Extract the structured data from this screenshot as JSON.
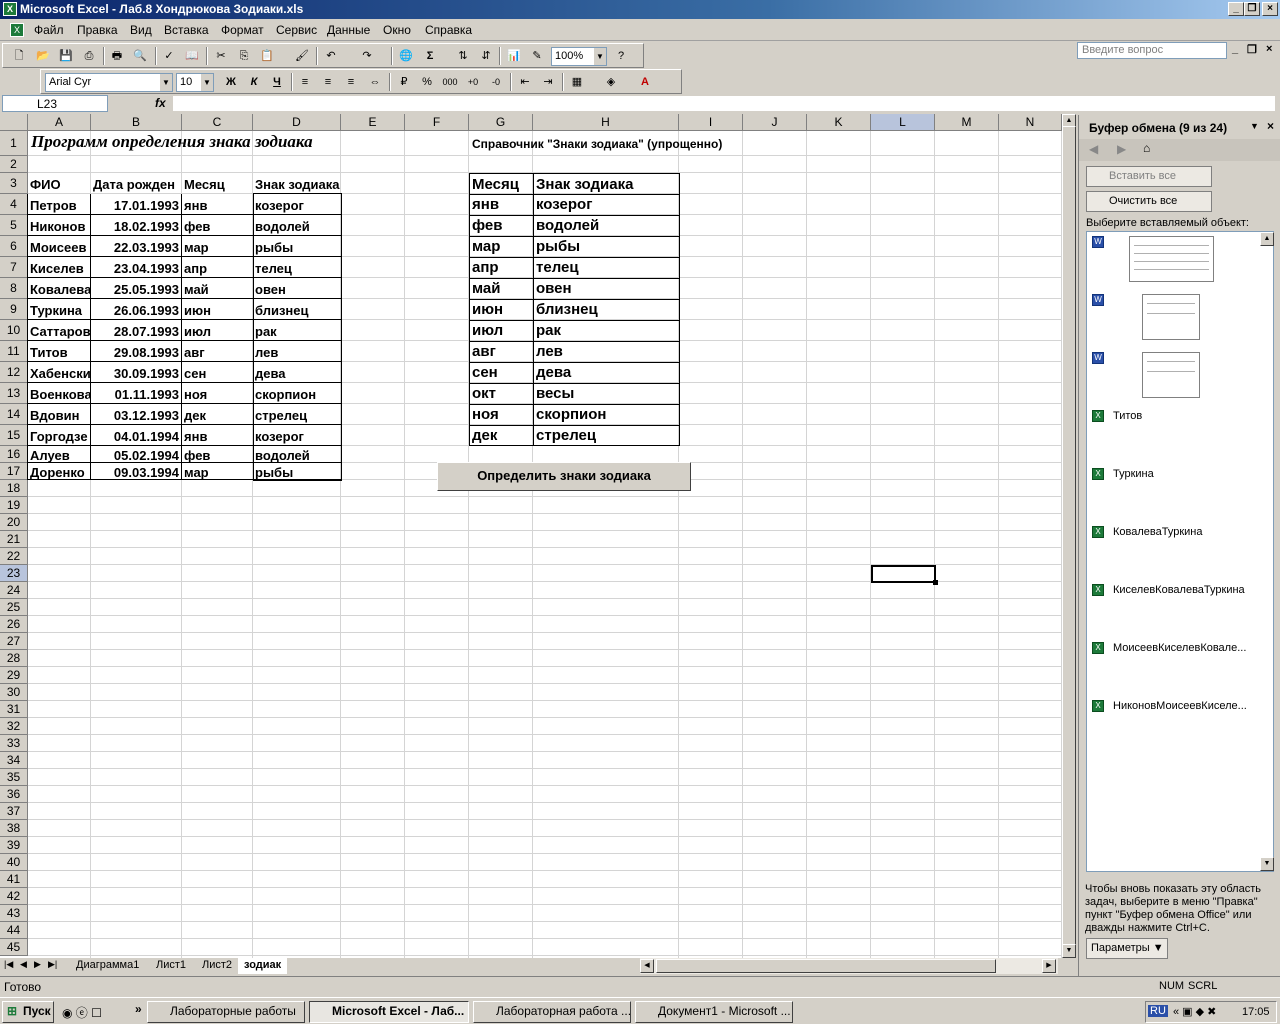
{
  "window": {
    "title": "Microsoft Excel - Лаб.8 Хондрюкова Зодиаки.xls"
  },
  "menu": [
    "Файл",
    "Правка",
    "Вид",
    "Вставка",
    "Формат",
    "Сервис",
    "Данные",
    "Окно",
    "Справка"
  ],
  "ask_placeholder": "Введите вопрос",
  "toolbar": {
    "zoom": "100%",
    "font": "Arial Cyr",
    "size": "10",
    "bold": "Ж",
    "italic": "К",
    "underline": "Ч",
    "percent": "%",
    "thousands": "000"
  },
  "formula": {
    "namebox": "L23",
    "fx": "fx",
    "value": ""
  },
  "columns": [
    "A",
    "B",
    "C",
    "D",
    "E",
    "F",
    "G",
    "H",
    "I",
    "J",
    "K",
    "L",
    "M",
    "N"
  ],
  "rows": [
    "1",
    "2",
    "3",
    "4",
    "5",
    "6",
    "7",
    "8",
    "9",
    "10",
    "11",
    "12",
    "13",
    "14",
    "15",
    "16",
    "17",
    "18",
    "19",
    "20",
    "21",
    "22",
    "23",
    "24",
    "25",
    "26",
    "27",
    "28",
    "29",
    "30",
    "31",
    "32",
    "33",
    "34",
    "35",
    "36",
    "37",
    "38",
    "39",
    "40",
    "41",
    "42",
    "43",
    "44",
    "45"
  ],
  "sheet": {
    "title": "Программ определения знака зодиака",
    "headers": [
      "ФИО",
      "Дата рожден",
      "Месяц",
      "Знак зодиака"
    ],
    "table": [
      [
        "Петров",
        "17.01.1993",
        "янв",
        "козерог"
      ],
      [
        "Никонов",
        "18.02.1993",
        "фев",
        "водолей"
      ],
      [
        "Моисеев",
        "22.03.1993",
        "мар",
        "рыбы"
      ],
      [
        "Киселев",
        "23.04.1993",
        "апр",
        "телец"
      ],
      [
        "Ковалева",
        "25.05.1993",
        "май",
        "овен"
      ],
      [
        "Туркина",
        "26.06.1993",
        "июн",
        "близнец"
      ],
      [
        "Саттаров",
        "28.07.1993",
        "июл",
        "рак"
      ],
      [
        "Титов",
        "29.08.1993",
        "авг",
        "лев"
      ],
      [
        "Хабенски",
        "30.09.1993",
        "сен",
        "дева"
      ],
      [
        "Военкова",
        "01.11.1993",
        "ноя",
        "скорпион"
      ],
      [
        "Вдовин",
        "03.12.1993",
        "дек",
        "стрелец"
      ],
      [
        "Горгодзе",
        "04.01.1994",
        "янв",
        "козерог"
      ],
      [
        "Алуев",
        "05.02.1994",
        "фев",
        "водолей"
      ],
      [
        "Доренко",
        "09.03.1994",
        "мар",
        "рыбы"
      ]
    ],
    "ref_title": "Справочник \"Знаки зодиака\" (упрощенно)",
    "ref_headers": [
      "Месяц",
      "Знак зодиака"
    ],
    "ref": [
      [
        "янв",
        "козерог"
      ],
      [
        "фев",
        "водолей"
      ],
      [
        "мар",
        "рыбы"
      ],
      [
        "апр",
        "телец"
      ],
      [
        "май",
        "овен"
      ],
      [
        "июн",
        "близнец"
      ],
      [
        "июл",
        "рак"
      ],
      [
        "авг",
        "лев"
      ],
      [
        "сен",
        "дева"
      ],
      [
        "окт",
        "весы"
      ],
      [
        "ноя",
        "скорпион"
      ],
      [
        "дек",
        "стрелец"
      ]
    ],
    "button": "Определить знаки зодиака"
  },
  "tabs": [
    "Диаграмма1",
    "Лист1",
    "Лист2",
    "зодиак"
  ],
  "status": {
    "left": "Готово",
    "num": "NUM",
    "scrl": "SCRL"
  },
  "taskpane": {
    "title": "Буфер обмена (9 из 24)",
    "paste_all": "Вставить все",
    "clear_all": "Очистить все",
    "choose": "Выберите вставляемый объект:",
    "items": [
      "Титов",
      "Туркина",
      "КовалеваТуркина",
      "КиселевКовалеваТуркина",
      "МоисеевКиселевКовале...",
      "НиконовМоисеевКиселе..."
    ],
    "note": "Чтобы вновь показать эту область задач, выберите в меню \"Правка\" пункт \"Буфер обмена Office\" или дважды нажмите Ctrl+C.",
    "params": "Параметры"
  },
  "taskbar": {
    "start": "Пуск",
    "buttons": [
      "Лабораторные работы",
      "Microsoft Excel - Лаб...",
      "Лабораторная работа ...",
      "Документ1 - Microsoft ..."
    ],
    "lang": "RU",
    "time": "17:05"
  }
}
